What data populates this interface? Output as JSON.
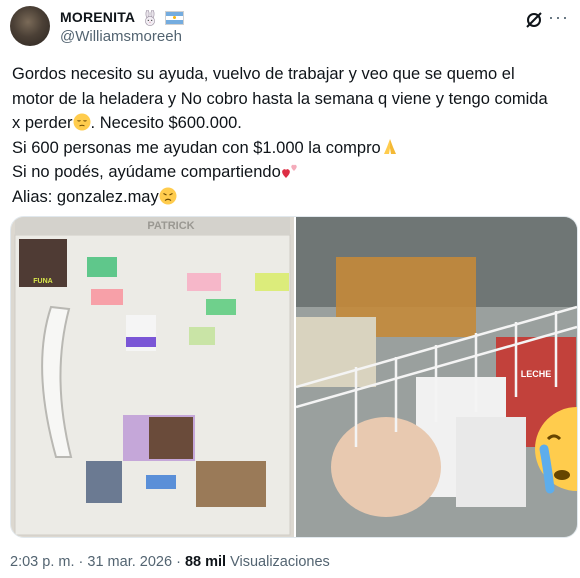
{
  "author": {
    "display_name": "MORENITA",
    "handle": "@Williamsmoreeh",
    "badge_icon": "rabbit-emoji",
    "flag_icon": "argentina-flag"
  },
  "tweet": {
    "lines": [
      "Gordos necesito su ayuda, vuelvo de trabajar y veo que se quemo el",
      "motor de la heladera y No cobro hasta la semana q viene y tengo comida",
      "x perder",
      ". Necesito $600.000.",
      "Si 600 personas me ayudan con $1.000 la compro",
      "Si no podés, ayúdame compartiendo",
      "Alias: gonzalez.may"
    ],
    "emojis": {
      "line3": "pensive-face",
      "line5": "folded-hands",
      "line6": "two-hearts",
      "line7": "disappointed-face"
    }
  },
  "media": {
    "left_photo": {
      "brand": "PATRICK",
      "magnet_text": "FUNA\nVIRA EN PRO"
    },
    "right_photo": {
      "package_text": "LECHE\nFRESCA"
    }
  },
  "footer": {
    "time": "2:03 p. m.",
    "separator": "·",
    "date": "31 mar. 2026",
    "views_count": "88 mil",
    "views_label": "Visualizaciones"
  },
  "colors": {
    "text": "#0f1419",
    "secondary": "#536471",
    "flag_blue": "#74acdf"
  }
}
